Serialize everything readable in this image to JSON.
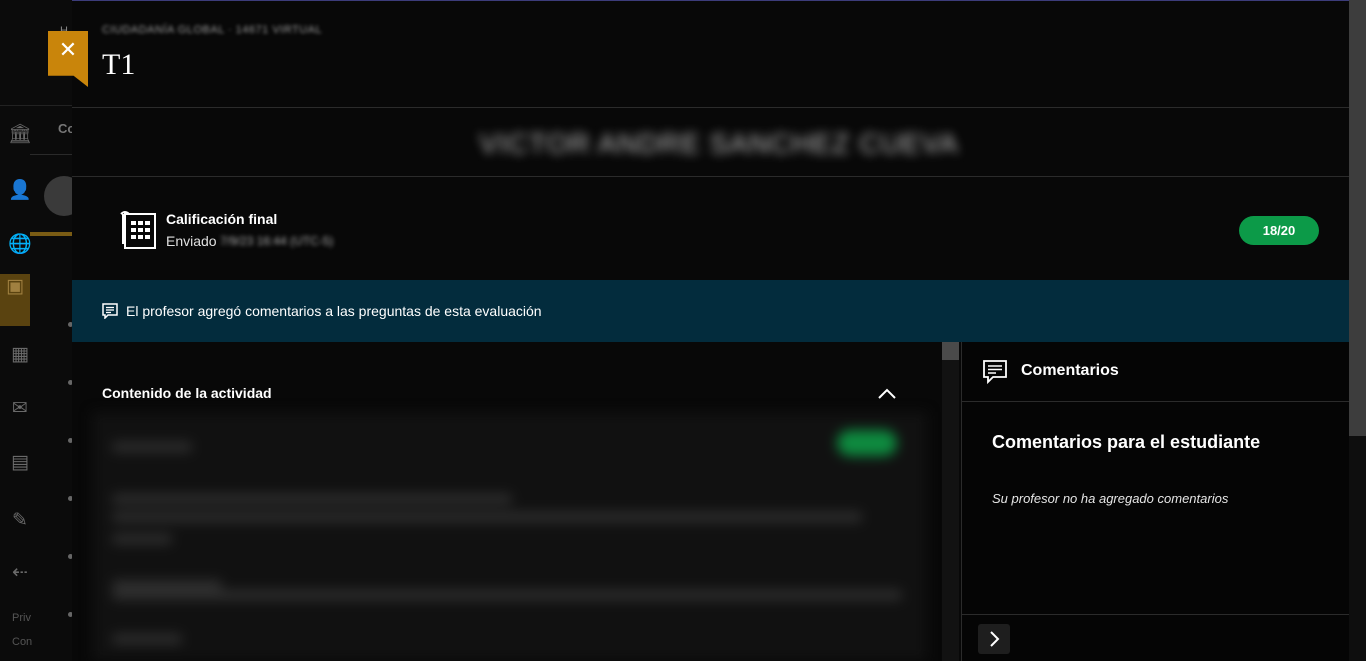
{
  "background": {
    "crumb_char": "H",
    "tab_label": "Co",
    "footer": [
      "Priv",
      "Con"
    ],
    "nav_icons": [
      "institution-icon",
      "profile-icon",
      "globe-icon",
      "courses-icon",
      "calendar-icon",
      "messages-icon",
      "grades-icon",
      "edit-icon",
      "logout-icon"
    ]
  },
  "header": {
    "breadcrumb": "CIUDADANÍA GLOBAL · 14671 VIRTUAL",
    "title": "T1",
    "close_icon": "close-icon"
  },
  "student": {
    "name": "VICTOR ANDRE SANCHEZ CUEVA"
  },
  "grade": {
    "label": "Calificación final",
    "sent_label": "Enviado",
    "sent_date": "7/9/23 16:44 (UTC-5)",
    "value": "18/20",
    "pill_color": "#0c9a48"
  },
  "banner": {
    "text": "El profesor agregó comentarios a las preguntas de esta evaluación",
    "color": "#032c3d"
  },
  "content": {
    "title": "Contenido de la actividad",
    "toggle_icon": "chevron-up-icon"
  },
  "comments": {
    "title": "Comentarios",
    "subtitle": "Comentarios para el estudiante",
    "empty_note": "Su profesor no ha agregado comentarios",
    "expand_icon": "chevron-right-icon"
  },
  "colors": {
    "accent": "#c9850b",
    "panel": "#080808"
  }
}
